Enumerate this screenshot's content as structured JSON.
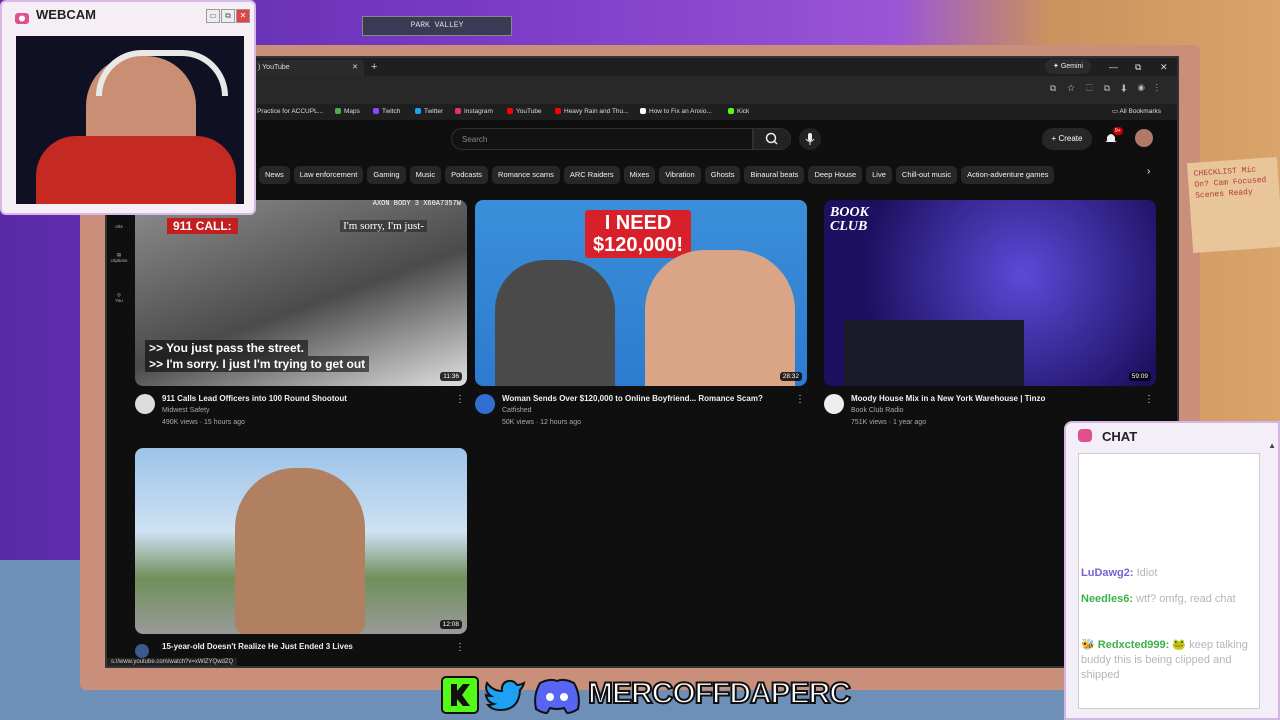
{
  "webcam": {
    "title": "WEBCAM",
    "btn_min": "▭",
    "btn_max": "⧉",
    "btn_close": "✕"
  },
  "browser": {
    "tab_title": ") YouTube",
    "tab_close": "✕",
    "new_tab": "+",
    "gemini": "Gemini",
    "win_min": "—",
    "win_max": "⧉",
    "win_close": "✕",
    "bookmarks": [
      "Practice for ACCUPL...",
      "Maps",
      "Twitch",
      "Twitter",
      "Instagram",
      "YouTube",
      "Heavy Rain and Thu...",
      "How to Fix an Anxio...",
      "Kick"
    ],
    "all_bookmarks": "All Bookmarks",
    "status_url": "s://www.youtube.com/watch?v=xWlZYQwdZQ"
  },
  "youtube": {
    "search_placeholder": "Search",
    "create_label": "Create",
    "notif_badge": "9+",
    "chips": [
      "News",
      "Law enforcement",
      "Gaming",
      "Music",
      "Podcasts",
      "Romance scams",
      "ARC Raiders",
      "Mixes",
      "Vibration",
      "Ghosts",
      "Binaural beats",
      "Deep House",
      "Live",
      "Chill-out music",
      "Action-adventure games"
    ],
    "sidebar": [
      "orts",
      "criptions",
      "You"
    ],
    "videos": [
      {
        "title": "911 Calls Lead Officers into 100 Round Shootout",
        "channel": "Midwest Safety",
        "stats": "490K views · 15 hours ago",
        "duration": "11:36",
        "overlay_top": "911 CALL:",
        "overlay_cam": "AXON BODY 3  X60A7357W",
        "overlay_quote": "I'm sorry, I'm just-",
        "caption1": ">> You just pass the street.",
        "caption2": ">> I'm sorry. I just I'm trying to get out"
      },
      {
        "title": "Woman Sends Over $120,000 to Online Boyfriend... Romance Scam?",
        "channel": "Catfished",
        "stats": "50K views · 12 hours ago",
        "duration": "28:32",
        "overlay_line1": "I NEED",
        "overlay_line2": "$120,000!"
      },
      {
        "title": "Moody House Mix in a New York Warehouse | Tinzo",
        "channel": "Book Club Radio",
        "stats": "751K views · 1 year ago",
        "duration": "59:09",
        "overlay_logo1": "BOOK",
        "overlay_logo2": "CLUB"
      },
      {
        "title": "15-year-old Doesn't Realize He Just Ended 3 Lives",
        "channel": "",
        "stats": "",
        "duration": "12:08"
      }
    ]
  },
  "chat": {
    "title": "CHAT",
    "messages": [
      {
        "user": "LuDawg2:",
        "text": " Idiot",
        "color": "#7a5fd0"
      },
      {
        "user": "Needles6:",
        "text": " wtf? omfg, read chat",
        "color": "#3cb04a"
      },
      {
        "user": "Redxcted999:",
        "text": " keep talking buddy this is being clipped and shipped",
        "color": "#3cb04a"
      }
    ]
  },
  "board": {
    "text": "CHECKLIST Mic On? Cam Focused Scenes Ready"
  },
  "room": {
    "sign": "PARK VALLEY"
  },
  "social": {
    "name": "MERCOFFDAPERC"
  }
}
